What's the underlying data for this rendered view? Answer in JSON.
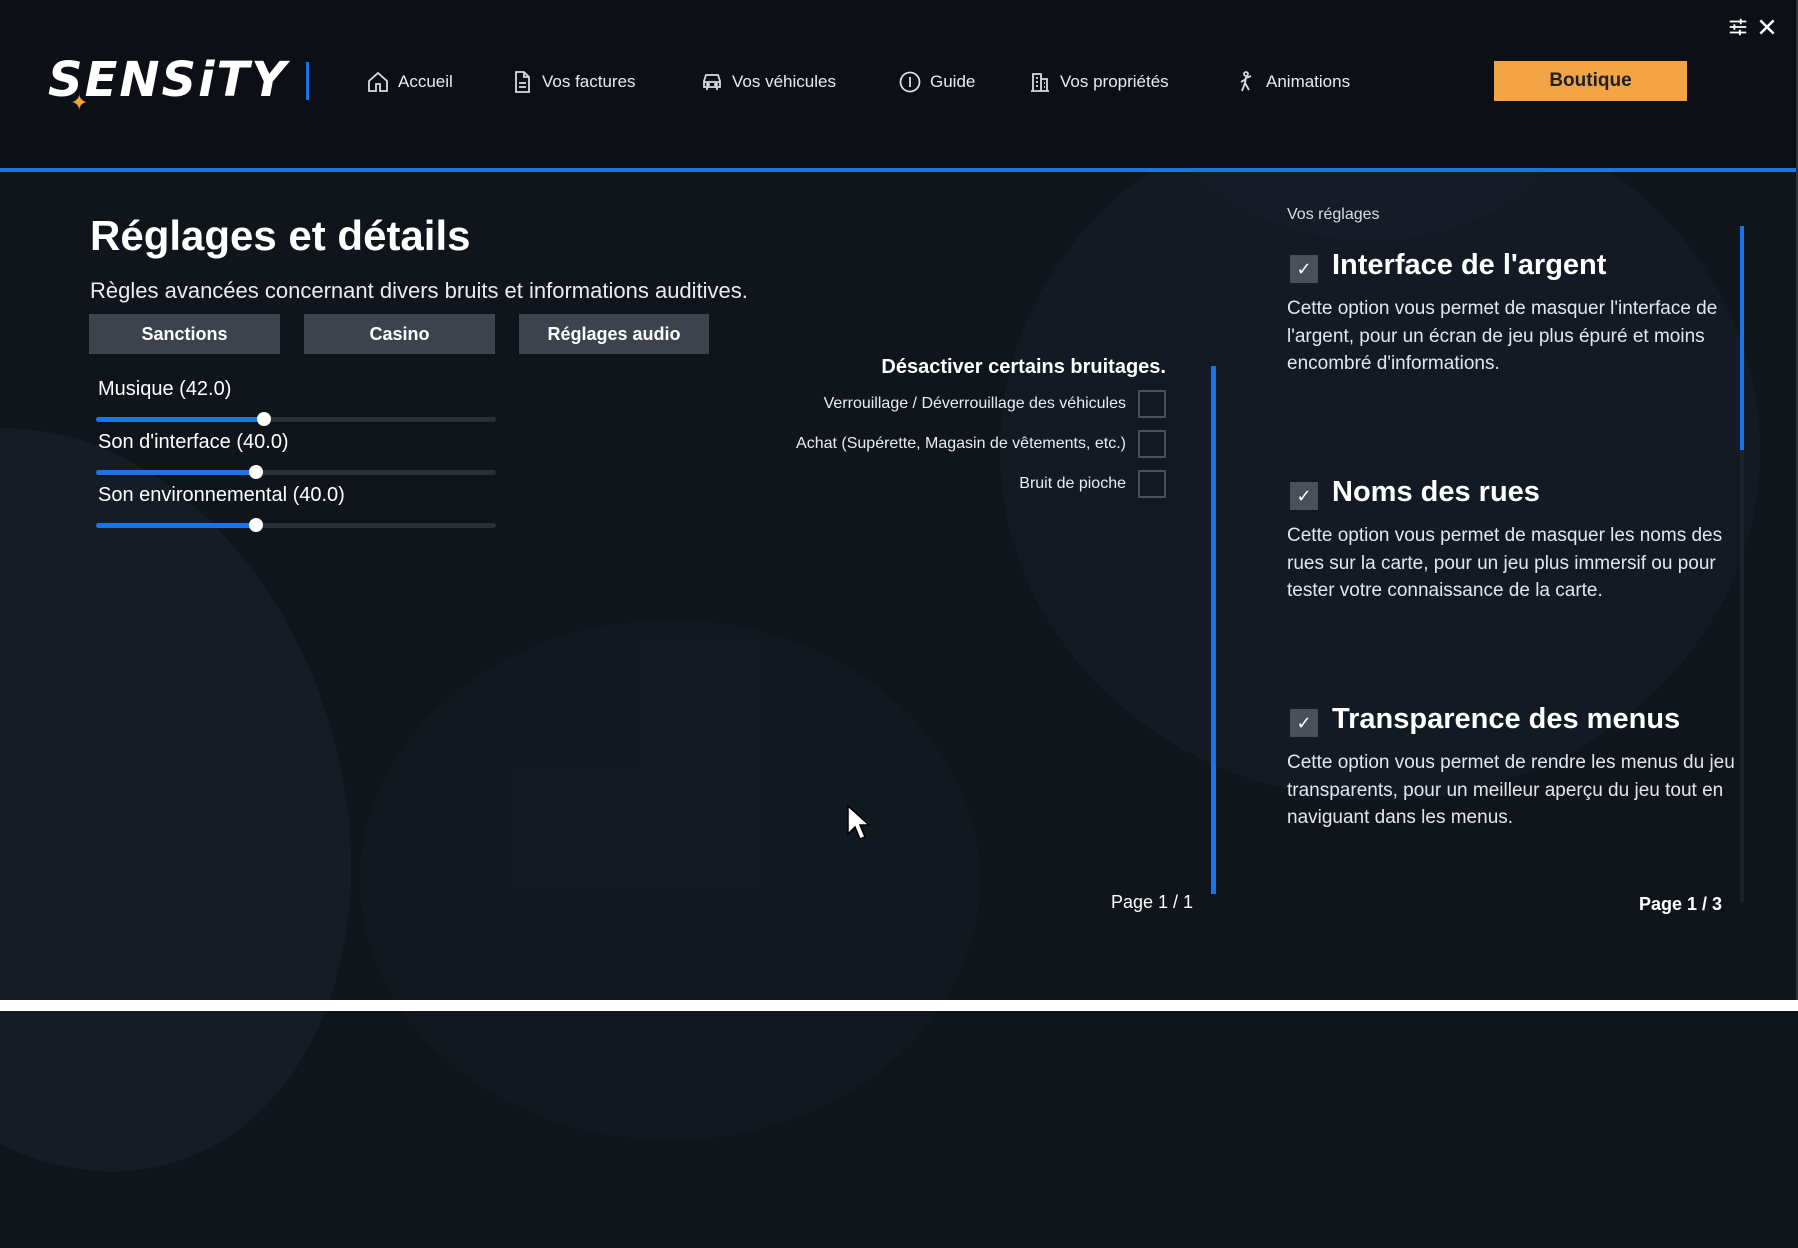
{
  "header": {
    "logo": "SENSiTY",
    "nav": [
      {
        "label": "Accueil",
        "icon": "home-icon"
      },
      {
        "label": "Vos factures",
        "icon": "document-icon"
      },
      {
        "label": "Vos véhicules",
        "icon": "car-icon"
      },
      {
        "label": "Guide",
        "icon": "info-icon"
      },
      {
        "label": "Vos propriétés",
        "icon": "building-icon"
      },
      {
        "label": "Animations",
        "icon": "dancer-icon"
      }
    ],
    "shop_label": "Boutique",
    "accent_color": "#1a73e8",
    "shop_color": "#f3a545"
  },
  "main": {
    "title": "Réglages et détails",
    "subtitle": "Règles avancées concernant divers bruits et informations auditives.",
    "tabs": [
      "Sanctions",
      "Casino",
      "Réglages audio"
    ],
    "sliders": [
      {
        "label": "Musique (42.0)",
        "value": 42
      },
      {
        "label": "Son d'interface (40.0)",
        "value": 40
      },
      {
        "label": "Son environnemental (40.0)",
        "value": 40
      }
    ],
    "sounds_title": "Désactiver certains bruitages.",
    "sound_toggles": [
      {
        "label": "Verrouillage / Déverrouillage des véhicules",
        "checked": false
      },
      {
        "label": "Achat (Supérette, Magasin de vêtements, etc.)",
        "checked": false
      },
      {
        "label": "Bruit de pioche",
        "checked": false
      }
    ],
    "page_indicator": "Page 1 / 1"
  },
  "settings_panel": {
    "caption": "Vos réglages",
    "items": [
      {
        "title": "Interface de l'argent",
        "checked": true,
        "description": "Cette option vous permet de masquer l'interface de l'argent, pour un écran de jeu plus épuré et moins encombré d'informations."
      },
      {
        "title": "Noms des rues",
        "checked": true,
        "description": "Cette option vous permet de masquer les noms des rues sur la carte, pour un jeu plus immersif ou pour tester votre connaissance de la carte."
      },
      {
        "title": "Transparence des menus",
        "checked": true,
        "description": "Cette option vous permet de rendre les menus du jeu transparents, pour un meilleur aperçu du jeu tout en naviguant dans les menus."
      }
    ],
    "page_indicator": "Page 1 / 3"
  }
}
